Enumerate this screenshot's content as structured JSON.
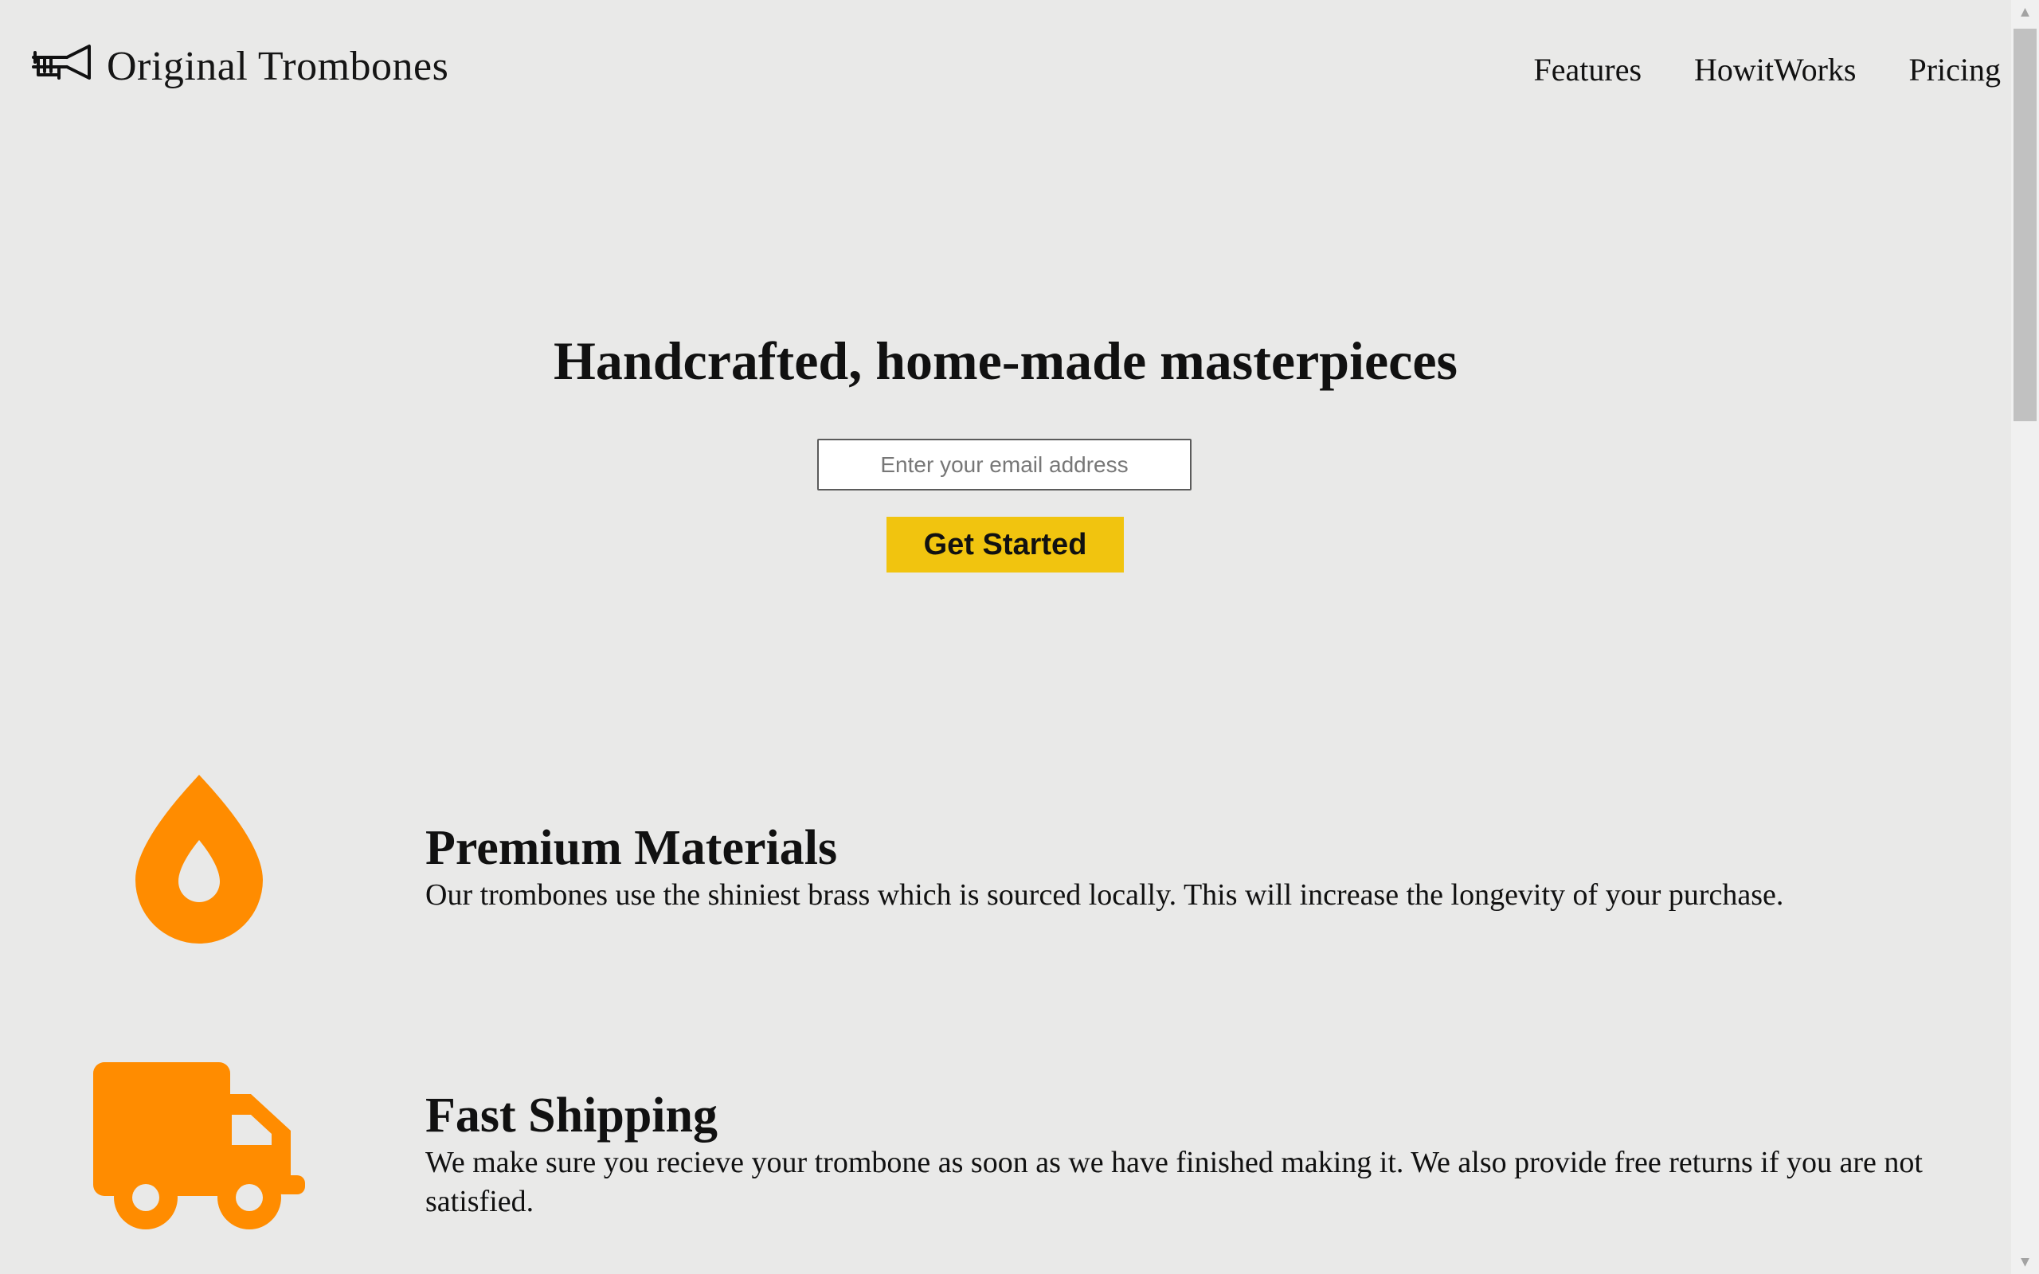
{
  "header": {
    "brand": "Original Trombones",
    "nav": [
      {
        "label": "Features"
      },
      {
        "label": "HowitWorks"
      },
      {
        "label": "Pricing"
      }
    ]
  },
  "hero": {
    "title": "Handcrafted, home-made masterpieces",
    "email_placeholder": "Enter your email address",
    "email_value": "",
    "cta_label": "Get Started"
  },
  "features": [
    {
      "icon": "fire-icon",
      "title": "Premium Materials",
      "description": "Our trombones use the shiniest brass which is sourced locally. This will increase the longevity of your purchase."
    },
    {
      "icon": "truck-icon",
      "title": "Fast Shipping",
      "description": "We make sure you recieve your trombone as soon as we have finished making it. We also provide free returns if you are not satisfied."
    }
  ],
  "colors": {
    "background": "#e9e9e8",
    "accent_orange": "#ff8c00",
    "button_yellow": "#f1c40f"
  },
  "scrollbar": {
    "up_arrow": "▲",
    "down_arrow": "▼"
  }
}
